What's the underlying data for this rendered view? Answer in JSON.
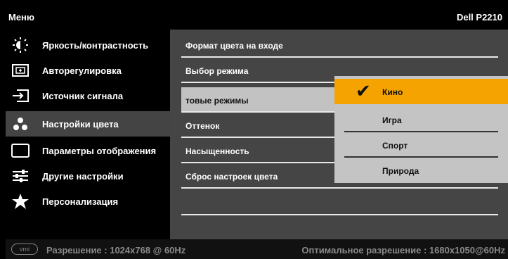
{
  "header": {
    "menu_title": "Меню",
    "model": "Dell P2210"
  },
  "sidebar": {
    "items": [
      {
        "label": "Яркость/контрастность",
        "icon": "brightness-icon"
      },
      {
        "label": "Авторегулировка",
        "icon": "auto-adjust-icon"
      },
      {
        "label": "Источник сигнала",
        "icon": "input-source-icon"
      },
      {
        "label": "Настройки цвета",
        "icon": "color-settings-icon",
        "active": true
      },
      {
        "label": "Параметры отображения",
        "icon": "display-settings-icon"
      },
      {
        "label": "Другие настройки",
        "icon": "other-settings-icon"
      },
      {
        "label": "Персонализация",
        "icon": "star-icon"
      }
    ]
  },
  "submenu": {
    "items": [
      {
        "label": "Формат цвета на входе"
      },
      {
        "label": "Выбор режима"
      },
      {
        "label": "товые режимы",
        "selected": true
      },
      {
        "label": "Оттенок"
      },
      {
        "label": "Насыщенность"
      },
      {
        "label": "Сброс настроек цвета"
      },
      {
        "label": ""
      }
    ]
  },
  "dropdown": {
    "items": [
      {
        "label": "Кино",
        "checked": true
      },
      {
        "label": "Игра"
      },
      {
        "label": "Спорт"
      },
      {
        "label": "Природа"
      }
    ]
  },
  "footer": {
    "logo_text": "vmi",
    "resolution": "Разрешение : 1024x768 @ 60Hz",
    "optimal": "Оптимальное разрешение : 1680x1050@60Hz"
  },
  "colors": {
    "accent": "#f5a300",
    "panel": "#454545",
    "selected_row": "#c2c2c2",
    "dropdown_bg": "#c4c4c4"
  }
}
